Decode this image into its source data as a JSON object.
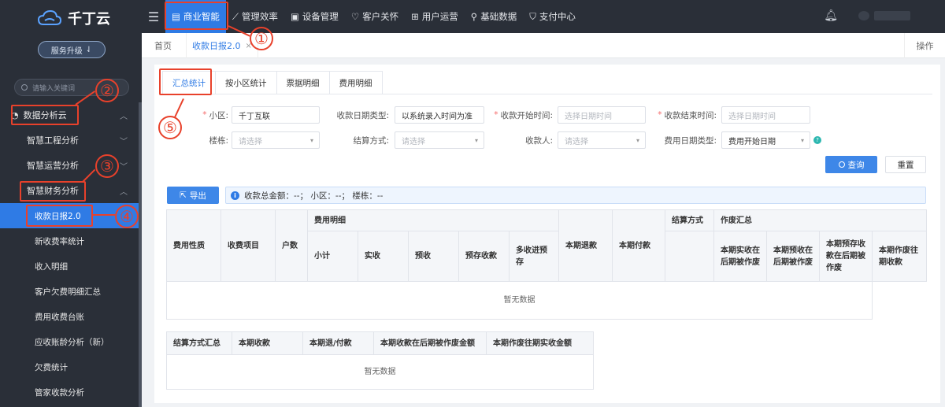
{
  "brand": {
    "name": "千丁云",
    "upgrade_label": "服务升级",
    "upgrade_icon": "upgrade-arrow-icon"
  },
  "sidebar": {
    "search_placeholder": "请输入关键词",
    "items": [
      {
        "label": "数据分析云",
        "level": 0
      },
      {
        "label": "智慧工程分析",
        "level": 1
      },
      {
        "label": "智慧运营分析",
        "level": 1
      },
      {
        "label": "智慧财务分析",
        "level": 1
      },
      {
        "label": "收款日报2.0",
        "level": 2,
        "active": true
      },
      {
        "label": "新收费率统计",
        "level": 2
      },
      {
        "label": "收入明细",
        "level": 2
      },
      {
        "label": "客户欠费明细汇总",
        "level": 2
      },
      {
        "label": "费用收费台账",
        "level": 2
      },
      {
        "label": "应收账龄分析（新）",
        "level": 2
      },
      {
        "label": "欠费统计",
        "level": 2
      },
      {
        "label": "管家收款分析",
        "level": 2
      }
    ]
  },
  "topnav": {
    "items": [
      {
        "label": "商业智能",
        "icon": "chart-icon",
        "active": true
      },
      {
        "label": "管理效率",
        "icon": "trend-icon"
      },
      {
        "label": "设备管理",
        "icon": "device-icon"
      },
      {
        "label": "客户关怀",
        "icon": "heart-icon"
      },
      {
        "label": "用户运营",
        "icon": "user-ops-icon"
      },
      {
        "label": "基础数据",
        "icon": "wrench-icon"
      },
      {
        "label": "支付中心",
        "icon": "shield-icon"
      }
    ]
  },
  "tabs": {
    "home": "首页",
    "current": "收款日报2.0",
    "close": "×",
    "ops": "操作"
  },
  "subtabs": [
    "汇总统计",
    "按小区统计",
    "票据明细",
    "费用明细"
  ],
  "filters": {
    "community_label": "小区:",
    "community_value": "千丁互联",
    "date_type_label": "收款日期类型:",
    "date_type_value": "以系统录入时间为准",
    "start_label": "收款开始时间:",
    "start_placeholder": "选择日期时间",
    "end_label": "收款结束时间:",
    "end_placeholder": "选择日期时间",
    "building_label": "楼栋:",
    "building_placeholder": "请选择",
    "settle_label": "结算方式:",
    "settle_placeholder": "请选择",
    "payee_label": "收款人:",
    "payee_placeholder": "请选择",
    "fee_date_type_label": "费用日期类型:",
    "fee_date_type_value": "费用开始日期",
    "help": "?"
  },
  "actions": {
    "query": "查询",
    "reset": "重置",
    "export": "导出"
  },
  "summary": "收款总金额：--；  小区：--；  楼栋：--",
  "table_main": {
    "h_fee_type": "费用性质",
    "h_item": "收费项目",
    "h_households": "户数",
    "h_detail": "费用明细",
    "h_refund": "本期退款",
    "h_payout": "本期付款",
    "h_settle": "结算方式",
    "h_void": "作废汇总",
    "detail_cols": [
      "小计",
      "实收",
      "预收",
      "预存收款",
      "多收进预存"
    ],
    "void_cols": [
      "本期实收在后期被作废",
      "本期预收在后期被作废",
      "本期预存收款在后期被作废",
      "本期作废往期收款"
    ],
    "empty": "暂无数据"
  },
  "table_sum": {
    "headers": [
      "结算方式汇总",
      "本期收款",
      "本期退/付款",
      "本期收款在后期被作废金额",
      "本期作废往期实收金额"
    ],
    "empty": "暂无数据"
  },
  "annotations": [
    "①",
    "②",
    "③",
    "④",
    "⑤"
  ],
  "colors": {
    "accent": "#2f7be5",
    "sidebar_bg": "#2a2f38",
    "annotation": "#e8412b"
  }
}
